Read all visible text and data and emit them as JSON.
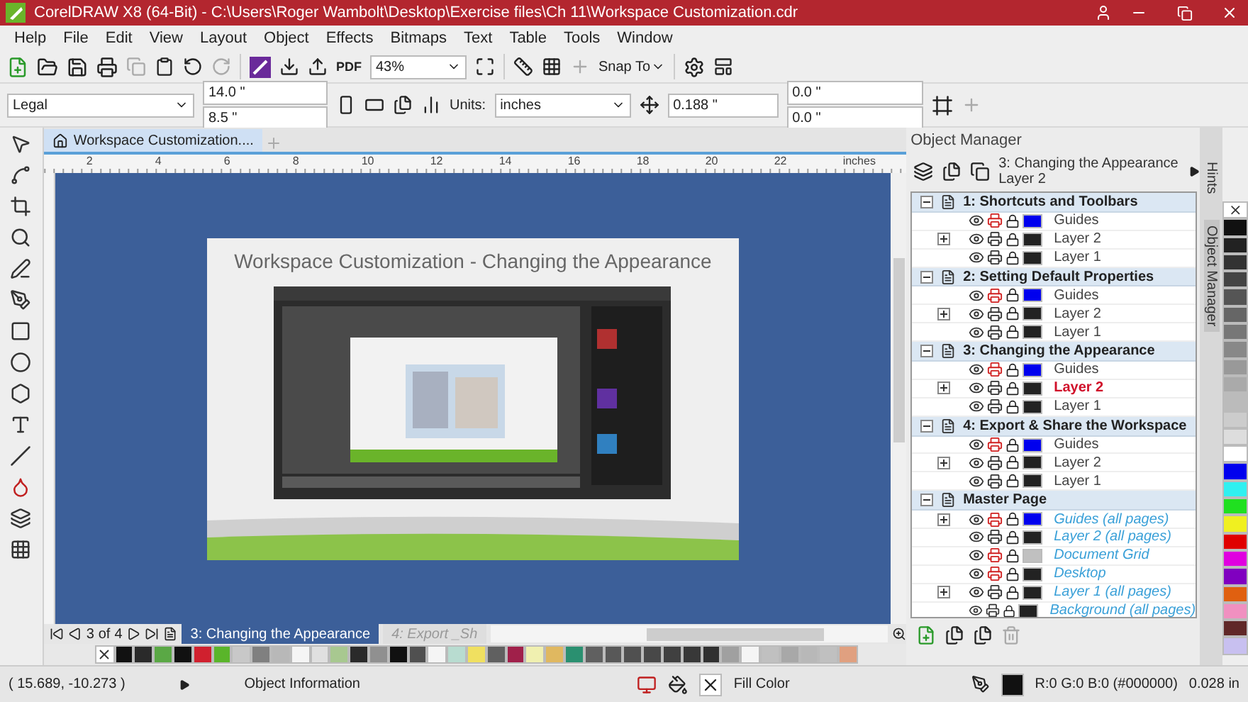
{
  "window": {
    "title": "CorelDRAW X8 (64-Bit) - C:\\Users\\Roger Wambolt\\Desktop\\Exercise files\\Ch 11\\Workspace Customization.cdr"
  },
  "menu": [
    "Help",
    "File",
    "Edit",
    "View",
    "Layout",
    "Object",
    "Effects",
    "Bitmaps",
    "Text",
    "Table",
    "Tools",
    "Window"
  ],
  "toolbar": {
    "pdf_label": "PDF",
    "zoom": "43%",
    "snap": "Snap To"
  },
  "property_bar": {
    "page_size": "Legal",
    "width": "14.0 \"",
    "height": "8.5 \"",
    "units_label": "Units:",
    "units": "inches",
    "nudge": "0.188 \"",
    "dup_x": "0.0 \"",
    "dup_y": "0.0 \""
  },
  "document_tab": {
    "title": "Workspace Customization...."
  },
  "ruler": {
    "ticks": [
      "2",
      "4",
      "6",
      "8",
      "10",
      "12",
      "14",
      "16",
      "18",
      "20",
      "22"
    ],
    "unit": "inches"
  },
  "page": {
    "title": "Workspace Customization - Changing the Appearance"
  },
  "page_nav": {
    "current": "3",
    "of": "of",
    "total": "4",
    "tabs": [
      {
        "label": "3: Changing the Appearance",
        "selected": true
      },
      {
        "label": "4: Export _Sh",
        "selected": false
      }
    ]
  },
  "palette": [
    {
      "kind": "none"
    },
    {
      "color": "#111111"
    },
    {
      "color": "#2a2a2a"
    },
    {
      "color": "#5aa845"
    },
    {
      "color": "#111111"
    },
    {
      "color": "#d0202e"
    },
    {
      "color": "#5ab52a"
    },
    {
      "color": "#c8c8c8"
    },
    {
      "color": "#808080"
    },
    {
      "color": "#b8b8b8"
    },
    {
      "color": "#f5f5f5"
    },
    {
      "color": "#e0e0e0"
    },
    {
      "color": "#a8c890"
    },
    {
      "color": "#2a2a2a"
    },
    {
      "color": "#909090"
    },
    {
      "color": "#111111"
    },
    {
      "color": "#505050"
    },
    {
      "color": "#f5f5f5"
    },
    {
      "color": "#b8dcd0"
    },
    {
      "color": "#f0e060"
    },
    {
      "color": "#606060"
    },
    {
      "color": "#a0204a"
    },
    {
      "color": "#f0f0b0"
    },
    {
      "color": "#e0b860"
    },
    {
      "color": "#2a9070"
    },
    {
      "color": "#606060"
    },
    {
      "color": "#585858"
    },
    {
      "color": "#505050"
    },
    {
      "color": "#484848"
    },
    {
      "color": "#404040"
    },
    {
      "color": "#383838"
    },
    {
      "color": "#303030"
    },
    {
      "color": "#a0a0a0"
    },
    {
      "color": "#f5f5f5"
    },
    {
      "color": "#c0c0c0"
    },
    {
      "color": "#a8a8a8"
    },
    {
      "color": "#b8b8b8"
    },
    {
      "color": "#c0c0c0"
    },
    {
      "color": "#e0a080"
    }
  ],
  "object_manager": {
    "title": "Object Manager",
    "current_page": "3: Changing the Appearance",
    "current_layer": "Layer 2",
    "pages": [
      {
        "name": "1: Shortcuts and Toolbars",
        "expanded": true,
        "layers": [
          {
            "name": "Guides",
            "color": "#0000ee",
            "expandable": false,
            "printable": false,
            "active": false,
            "master": false
          },
          {
            "name": "Layer 2",
            "color": "#222222",
            "expandable": true,
            "printable": true,
            "active": false,
            "master": false
          },
          {
            "name": "Layer 1",
            "color": "#222222",
            "expandable": false,
            "printable": true,
            "active": false,
            "master": false
          }
        ]
      },
      {
        "name": "2: Setting Default Properties",
        "expanded": true,
        "layers": [
          {
            "name": "Guides",
            "color": "#0000ee",
            "expandable": false,
            "printable": false,
            "active": false,
            "master": false
          },
          {
            "name": "Layer 2",
            "color": "#222222",
            "expandable": true,
            "printable": true,
            "active": false,
            "master": false
          },
          {
            "name": "Layer 1",
            "color": "#222222",
            "expandable": false,
            "printable": true,
            "active": false,
            "master": false
          }
        ]
      },
      {
        "name": "3: Changing the Appearance",
        "expanded": true,
        "layers": [
          {
            "name": "Guides",
            "color": "#0000ee",
            "expandable": false,
            "printable": false,
            "active": false,
            "master": false
          },
          {
            "name": "Layer 2",
            "color": "#222222",
            "expandable": true,
            "printable": true,
            "active": true,
            "master": false
          },
          {
            "name": "Layer 1",
            "color": "#222222",
            "expandable": false,
            "printable": true,
            "active": false,
            "master": false
          }
        ]
      },
      {
        "name": "4: Export & Share the Workspace",
        "expanded": true,
        "layers": [
          {
            "name": "Guides",
            "color": "#0000ee",
            "expandable": false,
            "printable": false,
            "active": false,
            "master": false
          },
          {
            "name": "Layer 2",
            "color": "#222222",
            "expandable": true,
            "printable": true,
            "active": false,
            "master": false
          },
          {
            "name": "Layer 1",
            "color": "#222222",
            "expandable": false,
            "printable": true,
            "active": false,
            "master": false
          }
        ]
      },
      {
        "name": "Master Page",
        "expanded": true,
        "layers": [
          {
            "name": "Guides (all pages)",
            "color": "#0000ee",
            "expandable": true,
            "printable": false,
            "active": false,
            "master": true
          },
          {
            "name": "Layer 2 (all pages)",
            "color": "#222222",
            "expandable": false,
            "printable": true,
            "active": false,
            "master": true
          },
          {
            "name": "Document Grid",
            "color": "#c0c0c0",
            "expandable": false,
            "printable": false,
            "active": false,
            "master": true
          },
          {
            "name": "Desktop",
            "color": "#222222",
            "expandable": false,
            "printable": false,
            "active": false,
            "master": true
          },
          {
            "name": "Layer 1 (all pages)",
            "color": "#222222",
            "expandable": true,
            "printable": true,
            "active": false,
            "master": true
          },
          {
            "name": "Background (all pages)",
            "color": "#222222",
            "expandable": false,
            "printable": true,
            "active": false,
            "master": true
          }
        ]
      }
    ]
  },
  "docker_tabs": [
    {
      "label": "Hints",
      "selected": false
    },
    {
      "label": "Object Manager",
      "selected": true
    }
  ],
  "side_palette": [
    {
      "kind": "none"
    },
    {
      "color": "#111111"
    },
    {
      "color": "#222222"
    },
    {
      "color": "#333333"
    },
    {
      "color": "#444444"
    },
    {
      "color": "#555555"
    },
    {
      "color": "#666666"
    },
    {
      "color": "#777777"
    },
    {
      "color": "#888888"
    },
    {
      "color": "#999999"
    },
    {
      "color": "#aaaaaa"
    },
    {
      "color": "#bbbbbb"
    },
    {
      "color": "#cccccc"
    },
    {
      "color": "#dddddd"
    },
    {
      "color": "#ffffff"
    },
    {
      "color": "#0000ee"
    },
    {
      "color": "#30f0f0"
    },
    {
      "color": "#20e020"
    },
    {
      "color": "#f0f020"
    },
    {
      "color": "#e00000"
    },
    {
      "color": "#e000e0"
    },
    {
      "color": "#8000c0"
    },
    {
      "color": "#e06010"
    },
    {
      "color": "#f090c0"
    },
    {
      "color": "#602828"
    },
    {
      "color": "#c8c0f0"
    }
  ],
  "status_bar": {
    "coords": "( 15.689, -10.273 )",
    "info": "Object Information",
    "fill": "Fill Color",
    "outline": "R:0 G:0 B:0 (#000000)",
    "outline_width": "0.028 in"
  }
}
